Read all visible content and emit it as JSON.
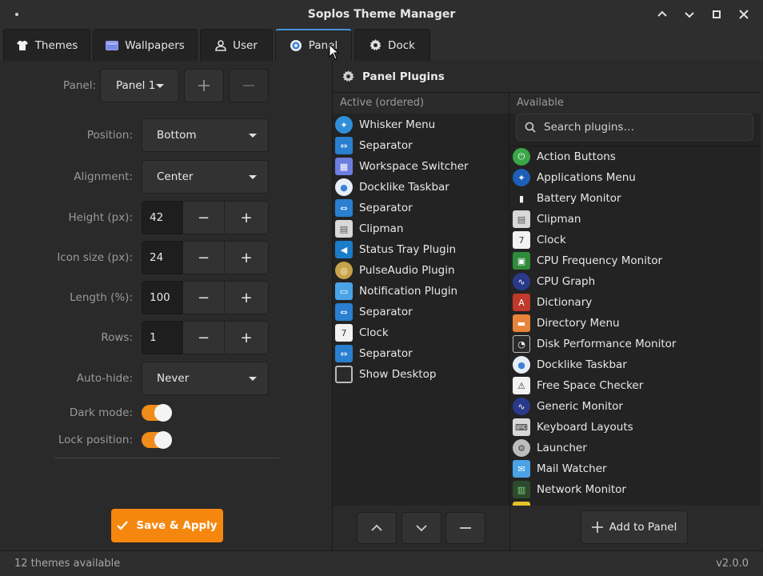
{
  "window": {
    "title": "Soplos Theme Manager"
  },
  "tabs": [
    {
      "label": "Themes",
      "icon": "shirt-icon"
    },
    {
      "label": "Wallpapers",
      "icon": "image-icon"
    },
    {
      "label": "User",
      "icon": "user-icon"
    },
    {
      "label": "Panel",
      "icon": "panel-icon",
      "active": true
    },
    {
      "label": "Dock",
      "icon": "gear-icon"
    }
  ],
  "left": {
    "panel_label": "Panel:",
    "panel_value": "Panel 1",
    "position_label": "Position:",
    "position_value": "Bottom",
    "alignment_label": "Alignment:",
    "alignment_value": "Center",
    "height_label": "Height (px):",
    "height_value": "42",
    "iconsize_label": "Icon size (px):",
    "iconsize_value": "24",
    "length_label": "Length (%):",
    "length_value": "100",
    "rows_label": "Rows:",
    "rows_value": "1",
    "autohide_label": "Auto-hide:",
    "autohide_value": "Never",
    "darkmode_label": "Dark mode:",
    "darkmode_on": true,
    "lockpos_label": "Lock position:",
    "lockpos_on": true,
    "save_label": "Save & Apply"
  },
  "right": {
    "header": "Panel Plugins",
    "active_header": "Active (ordered)",
    "available_header": "Available",
    "search_placeholder": "Search plugins…",
    "add_label": "Add to Panel",
    "active_items": [
      "Whisker Menu",
      "Separator",
      "Workspace Switcher",
      "Docklike Taskbar",
      "Separator",
      "Clipman",
      "Status Tray Plugin",
      "PulseAudio Plugin",
      "Notification Plugin",
      "Separator",
      "Clock",
      "Separator",
      "Show Desktop"
    ],
    "available_items": [
      "Action Buttons",
      "Applications Menu",
      "Battery Monitor",
      "Clipman",
      "Clock",
      "CPU Frequency Monitor",
      "CPU Graph",
      "Dictionary",
      "Directory Menu",
      "Disk Performance Monitor",
      "Docklike Taskbar",
      "Free Space Checker",
      "Generic Monitor",
      "Keyboard Layouts",
      "Launcher",
      "Mail Watcher",
      "Network Monitor"
    ]
  },
  "status": {
    "left": "12 themes available",
    "right": "v2.0.0"
  },
  "colors": {
    "accent": "#f5870f",
    "tab_active": "#4a90d9",
    "background": "#2a2a2a"
  }
}
